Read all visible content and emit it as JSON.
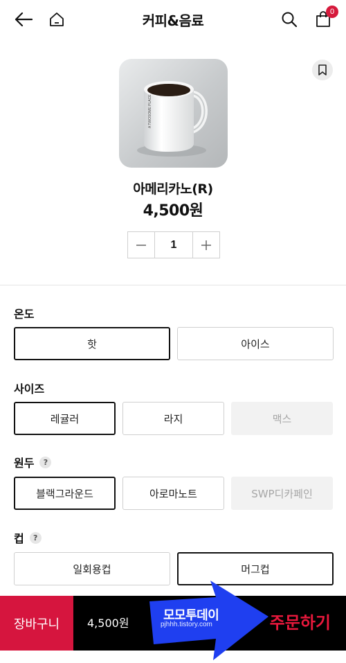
{
  "header": {
    "title": "커피&음료",
    "cart_count": "0"
  },
  "product": {
    "name": "아메리카노(R)",
    "price": "4,500원",
    "quantity": "1"
  },
  "sections": {
    "temperature": {
      "label": "온도",
      "options": [
        "핫",
        "아이스"
      ],
      "selected": "핫"
    },
    "size": {
      "label": "사이즈",
      "options": [
        "레귤러",
        "라지",
        "맥스"
      ],
      "selected": "레귤러",
      "disabled": [
        "맥스"
      ]
    },
    "bean": {
      "label": "원두",
      "help": "?",
      "options": [
        "블랙그라운드",
        "아로마노트",
        "SWP디카페인"
      ],
      "selected": "블랙그라운드",
      "disabled": [
        "SWP디카페인"
      ]
    },
    "cup": {
      "label": "컵",
      "help": "?",
      "options": [
        "일회용컵",
        "머그컵"
      ],
      "selected": "머그컵"
    }
  },
  "bottom": {
    "cart_label": "장바구니",
    "total": "4,500원",
    "order_label": "주문하기"
  },
  "watermark": {
    "title": "모모투데이",
    "url": "pjhhh.tistory.com"
  },
  "colors": {
    "accent": "#d6153e",
    "order_text": "#e8183c",
    "arrow": "#1f3ff0",
    "bar": "#000000"
  },
  "icons": [
    "back-arrow-icon",
    "home-icon",
    "search-icon",
    "cart-icon",
    "bookmark-icon",
    "minus-icon",
    "plus-icon",
    "help-icon"
  ]
}
